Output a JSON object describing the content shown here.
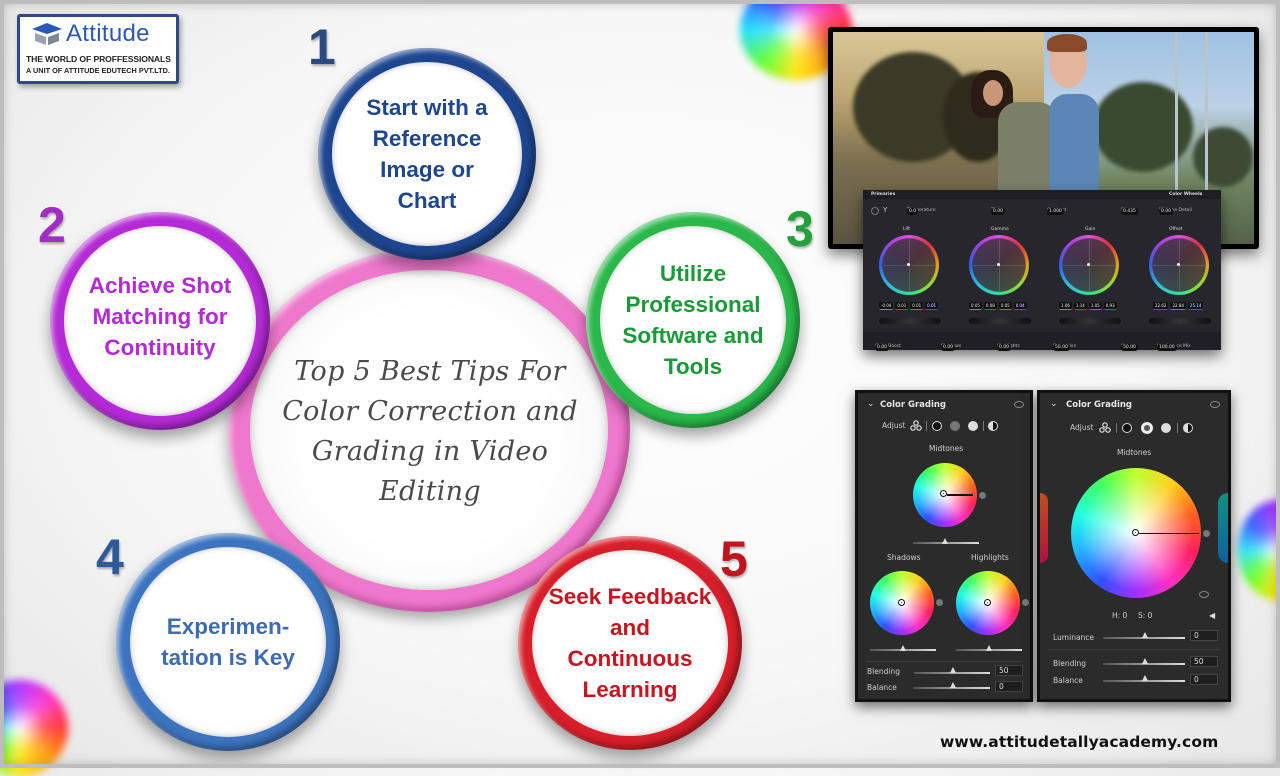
{
  "logo": {
    "name": "Attitude",
    "tagline": "THE WORLD OF PROFFESSIONALS",
    "subline": "A UNIT OF ATTITUDE EDUTECH PVT.LTD."
  },
  "center": {
    "title": "Top 5 Best Tips For Color Correction and Grading in Video Editing",
    "ring_color": "#ee78cc"
  },
  "tips": [
    {
      "number": "1",
      "text": "Start with a Reference Image or Chart",
      "color": "#1e4690"
    },
    {
      "number": "2",
      "text": "Achieve Shot Matching for Continuity",
      "color": "#b42ad6"
    },
    {
      "number": "3",
      "text": "Utilize Professional Software and Tools",
      "color": "#1ea03a"
    },
    {
      "number": "4",
      "text": "Experimen- tation is Key",
      "color": "#3d6bb3"
    },
    {
      "number": "5",
      "text": "Seek Feedback and Continuous Learning",
      "color": "#d01a26"
    }
  ],
  "resolve_panel": {
    "title": "Primaries",
    "mode": "Color Wheels",
    "top_controls": [
      {
        "label": "Temperature",
        "value": "0.0"
      },
      {
        "label": "Tint",
        "value": "0.00"
      },
      {
        "label": "Contrast",
        "value": "1.000"
      },
      {
        "label": "Pivot",
        "value": "0.435"
      },
      {
        "label": "Midtone Detail",
        "value": "0.00"
      }
    ],
    "wheels": [
      {
        "label": "Lift",
        "values": [
          "-0.04",
          "0.01",
          "0.01",
          "0.01"
        ]
      },
      {
        "label": "Gamma",
        "values": [
          "0.05",
          "0.08",
          "0.05",
          "0.04"
        ]
      },
      {
        "label": "Gain",
        "values": [
          "1.06",
          "1.14",
          "1.05",
          "0.93"
        ]
      },
      {
        "label": "Offset",
        "values": [
          "22.62",
          "22.84",
          "25.14"
        ]
      }
    ],
    "bottom_controls": [
      {
        "label": "Color Boost",
        "value": "0.00"
      },
      {
        "label": "Shadows",
        "value": "0.00"
      },
      {
        "label": "Highlights",
        "value": "0.00"
      },
      {
        "label": "Saturation",
        "value": "50.00"
      },
      {
        "label": "Hue",
        "value": "50.00"
      },
      {
        "label": "Luminance Mix",
        "value": "100.00"
      }
    ]
  },
  "lr_panel_small": {
    "title": "Color Grading",
    "adjust_label": "Adjust",
    "midtones_label": "Midtones",
    "shadows_label": "Shadows",
    "highlights_label": "Highlights",
    "blending_label": "Blending",
    "blending_value": "50",
    "balance_label": "Balance",
    "balance_value": "0"
  },
  "lr_panel_large": {
    "title": "Color Grading",
    "adjust_label": "Adjust",
    "midtones_label": "Midtones",
    "hue_readout": "H: 0",
    "sat_readout": "S: 0",
    "luminance_label": "Luminance",
    "luminance_value": "0",
    "blending_label": "Blending",
    "blending_value": "50",
    "balance_label": "Balance",
    "balance_value": "0"
  },
  "footer": {
    "url": "www.attitudetallyacademy.com"
  }
}
